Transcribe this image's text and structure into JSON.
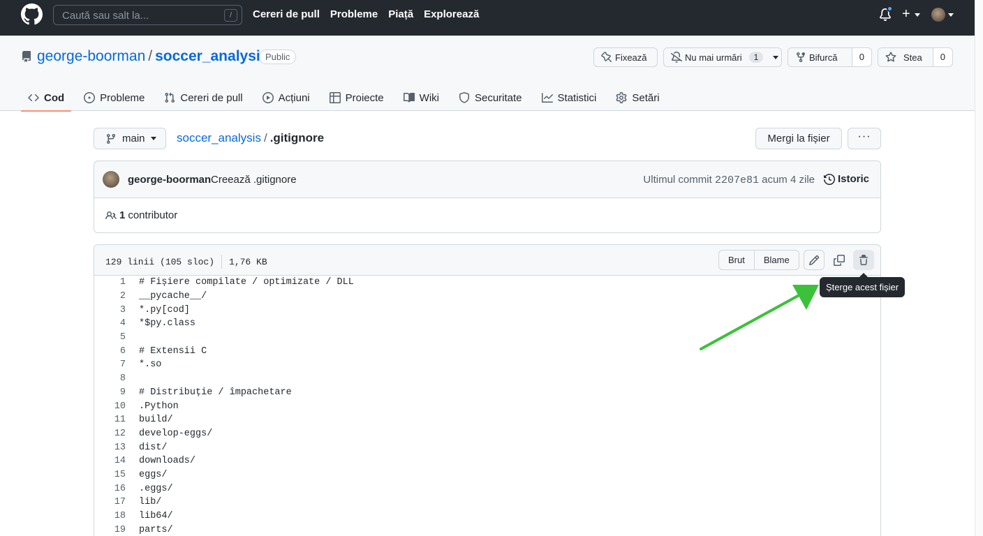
{
  "header": {
    "search_placeholder": "Caută sau salt la...",
    "search_shortcut": "/",
    "nav": [
      "Cereri de pull",
      "Probleme",
      "Piață",
      "Explorează"
    ],
    "plus_icon": "+"
  },
  "repo": {
    "owner": "george-boorman",
    "separator": "/",
    "name": "soccer_analysis",
    "visibility": "Public",
    "pin_label": "Fixează",
    "unwatch_label": "Nu mai urmări",
    "watch_count": "1",
    "fork_label": "Bifurcă",
    "fork_count": "0",
    "star_label": "Stea",
    "star_count": "0",
    "tabs": [
      {
        "label": "Cod",
        "icon": "code-icon"
      },
      {
        "label": "Probleme",
        "icon": "issue-icon"
      },
      {
        "label": "Cereri de pull",
        "icon": "pull-request-icon"
      },
      {
        "label": "Acțiuni",
        "icon": "play-icon"
      },
      {
        "label": "Proiecte",
        "icon": "table-icon"
      },
      {
        "label": "Wiki",
        "icon": "book-icon"
      },
      {
        "label": "Securitate",
        "icon": "shield-icon"
      },
      {
        "label": "Statistici",
        "icon": "graph-icon"
      },
      {
        "label": "Setări",
        "icon": "gear-icon"
      }
    ]
  },
  "file_nav": {
    "branch": "main",
    "repo_link": "soccer_analysis",
    "separator": "/",
    "file_name": ".gitignore",
    "goto_label": "Mergi la fișier",
    "more_label": "···"
  },
  "commit": {
    "author": "george-boorman",
    "message": "Creează .gitignore",
    "meta_prefix": "Ultimul commit",
    "sha": "2207e81",
    "age": "acum 4 zile",
    "history_label": "Istoric",
    "contrib_count": "1",
    "contrib_label": "contributor"
  },
  "file": {
    "lines_info": "129 linii (105 sloc)",
    "size": "1,76 KB",
    "raw_label": "Brut",
    "blame_label": "Blame",
    "tooltip": "Șterge acest fișier",
    "code_lines": [
      {
        "n": "1",
        "text": "# Fișiere compilate / optimizate / DLL"
      },
      {
        "n": "2",
        "text": "__pycache__/"
      },
      {
        "n": "3",
        "text": "*.py[cod]"
      },
      {
        "n": "4",
        "text": "*$py.class"
      },
      {
        "n": "5",
        "text": ""
      },
      {
        "n": "6",
        "text": "# Extensii C"
      },
      {
        "n": "7",
        "text": "*.so"
      },
      {
        "n": "8",
        "text": ""
      },
      {
        "n": "9",
        "text": "# Distribuție / împachetare"
      },
      {
        "n": "10",
        "text": ".Python"
      },
      {
        "n": "11",
        "text": "build/"
      },
      {
        "n": "12",
        "text": "develop-eggs/"
      },
      {
        "n": "13",
        "text": "dist/"
      },
      {
        "n": "14",
        "text": "downloads/"
      },
      {
        "n": "15",
        "text": "eggs/"
      },
      {
        "n": "16",
        "text": ".eggs/"
      },
      {
        "n": "17",
        "text": "lib/"
      },
      {
        "n": "18",
        "text": "lib64/"
      },
      {
        "n": "19",
        "text": "parts/"
      }
    ]
  },
  "colors": {
    "header_bg": "#24292f",
    "link": "#0969da",
    "active_tab": "#fd8c73",
    "annotation_arrow": "#3cc13b"
  }
}
